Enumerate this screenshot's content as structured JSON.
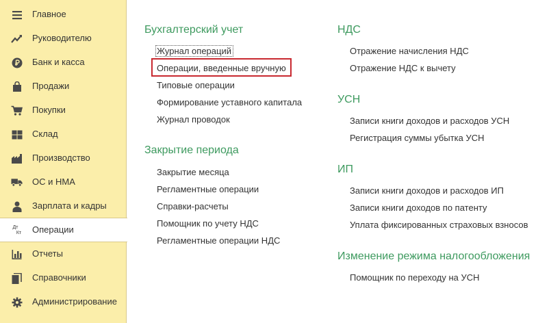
{
  "sidebar": {
    "items": [
      {
        "label": "Главное",
        "icon": "menu-icon"
      },
      {
        "label": "Руководителю",
        "icon": "trend-icon"
      },
      {
        "label": "Банк и касса",
        "icon": "ruble-coin-icon"
      },
      {
        "label": "Продажи",
        "icon": "shopping-bag-icon"
      },
      {
        "label": "Покупки",
        "icon": "cart-icon"
      },
      {
        "label": "Склад",
        "icon": "warehouse-grid-icon"
      },
      {
        "label": "Производство",
        "icon": "factory-icon"
      },
      {
        "label": "ОС и НМА",
        "icon": "truck-icon"
      },
      {
        "label": "Зарплата и кадры",
        "icon": "person-icon"
      },
      {
        "label": "Операции",
        "icon": "debit-credit-icon",
        "active": true,
        "icon_text_top": "Дт",
        "icon_text_bottom": "Кт"
      },
      {
        "label": "Отчеты",
        "icon": "bar-chart-icon"
      },
      {
        "label": "Справочники",
        "icon": "books-icon"
      },
      {
        "label": "Администрирование",
        "icon": "gear-icon"
      }
    ]
  },
  "sections": {
    "accounting": {
      "title": "Бухгалтерский учет",
      "links": [
        "Журнал операций",
        "Операции, введенные вручную",
        "Типовые операции",
        "Формирование уставного капитала",
        "Журнал проводок"
      ]
    },
    "period_close": {
      "title": "Закрытие периода",
      "links": [
        "Закрытие месяца",
        "Регламентные операции",
        "Справки-расчеты",
        "Помощник по учету НДС",
        "Регламентные операции НДС"
      ]
    },
    "vat": {
      "title": "НДС",
      "links": [
        "Отражение начисления НДС",
        "Отражение НДС к вычету"
      ]
    },
    "usn": {
      "title": "УСН",
      "links": [
        "Записи книги доходов и расходов УСН",
        "Регистрация суммы убытка УСН"
      ]
    },
    "ip": {
      "title": "ИП",
      "links": [
        "Записи книги доходов и расходов ИП",
        "Записи книги доходов по патенту",
        "Уплата фиксированных страховых взносов"
      ]
    },
    "tax_mode": {
      "title": "Изменение режима налогообложения",
      "links": [
        "Помощник по переходу на УСН"
      ]
    }
  },
  "colors": {
    "sidebar_bg": "#fbeeaa",
    "section_title": "#3e9a5f",
    "highlight_border": "#c8282f",
    "icon": "#4a4a4a"
  }
}
